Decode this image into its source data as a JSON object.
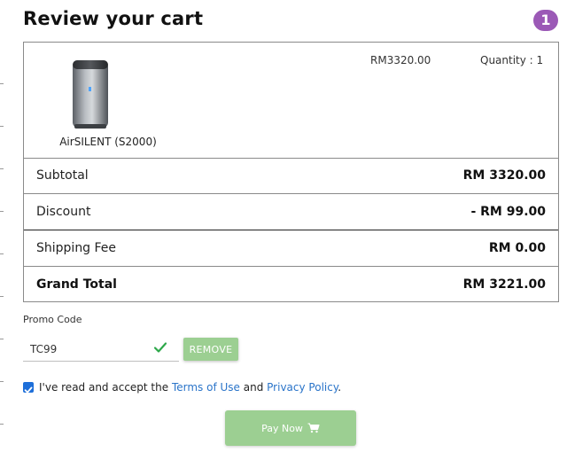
{
  "header": {
    "title": "Review your cart",
    "step_badge": "1"
  },
  "cart": {
    "item": {
      "name": "AirSILENT (S2000)",
      "price": "RM3320.00",
      "quantity": "Quantity : 1",
      "image_icon": "air-purifier-image"
    },
    "summary": [
      {
        "label": "Subtotal",
        "value": "RM 3320.00"
      },
      {
        "label": "Discount",
        "value": "- RM 99.00"
      },
      {
        "label": "Shipping Fee",
        "value": "RM 0.00"
      },
      {
        "label": "Grand Total",
        "value": "RM 3221.00"
      }
    ]
  },
  "promo": {
    "label": "Promo Code",
    "value": "TC99",
    "valid_icon": "check-icon",
    "remove_label": "REMOVE"
  },
  "terms": {
    "checked": true,
    "text_before": "I've read and accept the",
    "terms_link": "Terms of Use",
    "and": "and",
    "privacy_link": "Privacy Policy",
    "period": "."
  },
  "pay": {
    "label": "Pay Now",
    "icon": "cart-icon"
  },
  "colors": {
    "badge": "#9b59b6",
    "button_green": "#9ccf92",
    "link_blue": "#2a74c9",
    "check_green": "#2ea84a"
  }
}
